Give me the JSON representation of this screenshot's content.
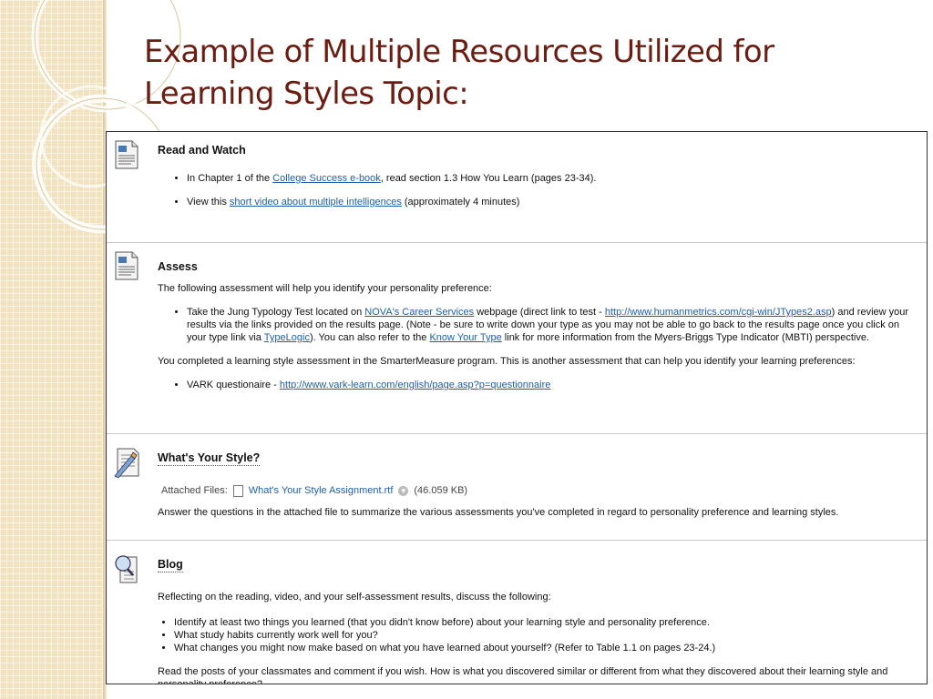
{
  "slide": {
    "title": "Example of Multiple Resources Utilized for Learning Styles Topic:"
  },
  "items": {
    "read_watch": {
      "title": "Read and Watch",
      "b1_pre": "In Chapter 1 of the ",
      "b1_link": "College Success e-book",
      "b1_post": ", read section 1.3 How You Learn (pages 23-34).",
      "b2_pre": "View this ",
      "b2_link": "short video about multiple intelligences",
      "b2_post": " (approximately 4 minutes)"
    },
    "assess": {
      "title": "Assess",
      "intro": "The following assessment will help you identify your personality preference:",
      "b1_pre": "Take the Jung Typology Test located on ",
      "b1_link1": "NOVA's Career Services",
      "b1_mid1": " webpage (direct link to test - ",
      "b1_link2": "http://www.humanmetrics.com/cgi-win/JTypes2.asp",
      "b1_mid2": ") and review your results via the links provided on the results page. (Note - be sure to write down your type as you may not be able to go back to the results page once you click on your type link via ",
      "b1_link3": "TypeLogic",
      "b1_mid3": "). You can also refer to the ",
      "b1_link4": "Know Your Type",
      "b1_post": " link for more information from the Myers-Briggs Type Indicator (MBTI) perspective.",
      "para2": "You completed a learning style assessment in the SmarterMeasure program. This is another assessment that can help you identify your learning preferences:",
      "b2_pre": "VARK questionaire - ",
      "b2_link": "http://www.vark-learn.com/english/page.asp?p=questionnaire"
    },
    "style": {
      "title": "What's Your Style?",
      "attached_label": "Attached Files:",
      "file_name": "What's Your Style Assignment.rtf",
      "file_size": "(46.059 KB)",
      "desc": "Answer the questions in the attached file to summarize the various assessments you've completed in regard to personality preference and learning styles."
    },
    "blog": {
      "title": "Blog",
      "intro": "Reflecting on the reading, video, and your self-assessment results, discuss the following:",
      "points": [
        "Identify at least two things you learned (that you didn't know before) about your learning style and personality preference.",
        "What study habits currently work well for you?",
        "What changes you might now make based on what you have learned about yourself? (Refer to Table 1.1 on pages 23-24.)"
      ],
      "closing": "Read the posts of your classmates and comment if you wish. How is what you discovered similar or different from what they discovered about their learning style and personality preference?"
    }
  },
  "icons": {
    "document": "document-icon",
    "assignment": "assignment-icon",
    "blog": "blog-icon"
  },
  "colors": {
    "title": "#6b1d12",
    "link": "#1f5fa8",
    "strip": "#f1e3c0"
  }
}
